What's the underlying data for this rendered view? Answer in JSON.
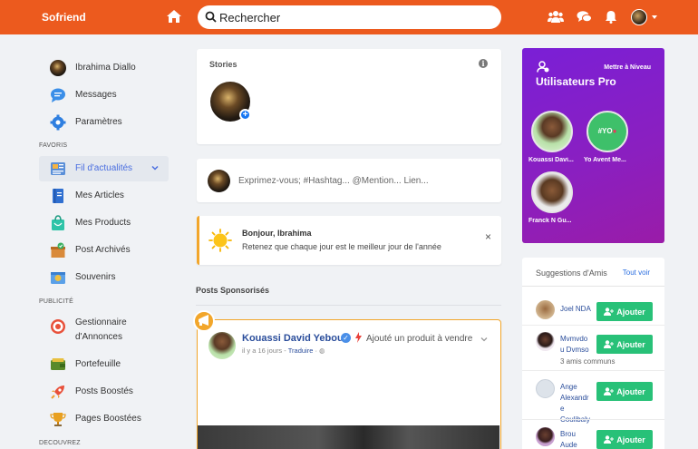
{
  "header": {
    "brand": "Sofriend",
    "search_placeholder": "Rechercher"
  },
  "sidebar": {
    "items": [
      {
        "label": "Ibrahima Diallo"
      },
      {
        "label": "Messages"
      },
      {
        "label": "Paramètres"
      }
    ],
    "section_favoris": "FAVORIS",
    "favoris": [
      {
        "label": "Fil d'actualités"
      },
      {
        "label": "Mes Articles"
      },
      {
        "label": "Mes Products"
      },
      {
        "label": "Post Archivés"
      },
      {
        "label": "Souvenirs"
      }
    ],
    "section_publicite": "PUBLICITÉ",
    "publicite": [
      {
        "label": "Gestionnaire d'Annonces"
      },
      {
        "label": "Portefeuille"
      },
      {
        "label": "Posts Boostés"
      },
      {
        "label": "Pages Boostées"
      }
    ],
    "section_decouvrez": "DECOUVREZ"
  },
  "stories": {
    "title": "Stories"
  },
  "composer": {
    "placeholder": "Exprimez-vous; #Hashtag... @Mention... Lien..."
  },
  "greeting": {
    "title": "Bonjour, Ibrahima",
    "message": "Retenez que chaque jour est le meilleur jour de l'année",
    "close": "×"
  },
  "sponsored": {
    "title": "Posts Sponsorisés",
    "post": {
      "author": "Kouassi David Yeboue",
      "action": "Ajouté un produit à vendre",
      "time": "il y a 16 jours",
      "translate": "Traduire"
    }
  },
  "pro": {
    "upgrade": "Mettre à Niveau",
    "title": "Utilisateurs Pro",
    "users": [
      {
        "name": "Kouassi Davi..."
      },
      {
        "name": "Yo Avent Me..."
      },
      {
        "name": "Franck N Gu..."
      }
    ],
    "badge_text": "#YO"
  },
  "suggestions": {
    "title": "Suggestions d'Amis",
    "see_all": "Tout voir",
    "add_label": "Ajouter",
    "people": [
      {
        "name": "Joel NDA",
        "mutual": ""
      },
      {
        "name": "Mvmvdo u Dvmso",
        "mutual": "3 amis communs"
      },
      {
        "name": "Ange Alexandr e Coulibaly",
        "mutual": ""
      },
      {
        "name": "Brou Aude",
        "mutual": ""
      }
    ]
  },
  "colors": {
    "header": "#ec5a1e",
    "accent_blue": "#2a4d9b",
    "add_button": "#28c178",
    "pro_bg": "#8b1fbf",
    "sponsored_border": "#f2a62b"
  }
}
